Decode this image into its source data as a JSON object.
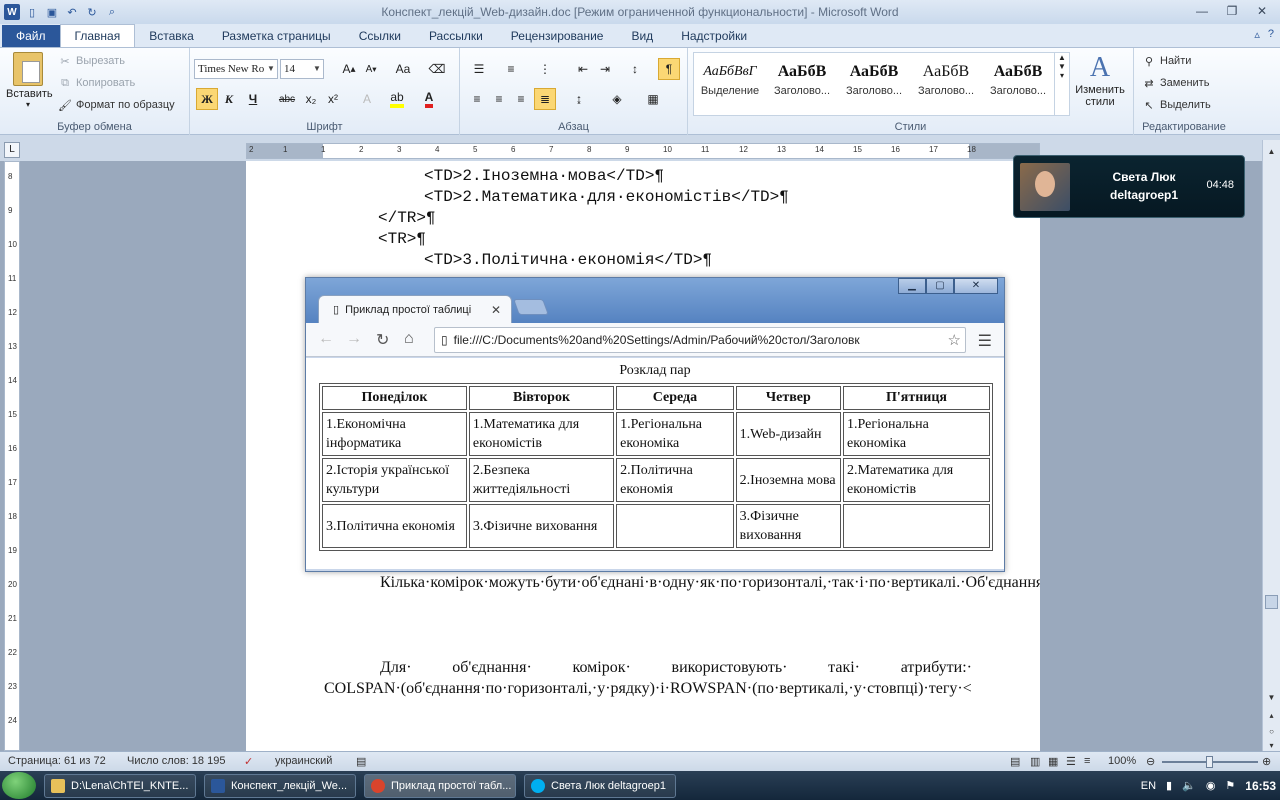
{
  "window": {
    "title": "Конспект_лекцій_Web-дизайн.doc [Режим ограниченной функциональности]  -  Microsoft Word",
    "icons": [
      "word-icon",
      "new-doc-icon",
      "save-icon",
      "undo-icon",
      "redo-icon",
      "print-preview-icon"
    ]
  },
  "ribbon_tabs": [
    "Файл",
    "Главная",
    "Вставка",
    "Разметка страницы",
    "Ссылки",
    "Рассылки",
    "Рецензирование",
    "Вид",
    "Надстройки"
  ],
  "ribbon": {
    "clipboard": {
      "paste": "Вставить",
      "cut": "Вырезать",
      "copy": "Копировать",
      "format_painter": "Формат по образцу",
      "label": "Буфер обмена"
    },
    "font": {
      "name": "Times New Ro",
      "size": "14",
      "bold": "Ж",
      "italic": "К",
      "underline": "Ч",
      "strike": "abc",
      "sub": "x₂",
      "sup": "x²",
      "label": "Шрифт"
    },
    "paragraph": {
      "label": "Абзац",
      "pilcrow": "¶"
    },
    "styles": {
      "items": [
        {
          "sample": "АаБбВвГ",
          "name": "Выделение"
        },
        {
          "sample": "АаБбВ",
          "name": "Заголово..."
        },
        {
          "sample": "АаБбВ",
          "name": "Заголово..."
        },
        {
          "sample": "АаБбВ",
          "name": "Заголово..."
        },
        {
          "sample": "АаБбВ",
          "name": "Заголово..."
        }
      ],
      "change": "Изменить стили",
      "label": "Стили"
    },
    "editing": {
      "find": "Найти",
      "replace": "Заменить",
      "select": "Выделить",
      "label": "Редактирование"
    }
  },
  "document": {
    "code_lines": [
      "<TD>2.Іноземна·мова</TD>¶",
      "<TD>2.Математика·для·економістів</TD>¶",
      "</TR>¶",
      "<TR>¶",
      "<TD>3.Політична·економія</TD>¶"
    ],
    "para1": "Кілька·комірок·можуть·бути·об'єднані·в·одну·як·по·горизонталі,·так·і·по·вертикалі.·Об'єднання·першого·типу·застосовують·тоді,·коли·потрібно·створити·для·кількох·стовпців·спільний·заголовок.·Коли·вміст·кількох·комірок·поспіль·у·стовпці·однаковий,·їх·об'єд¬нують·по·вертикалі.¶",
    "para2": "Для· об'єднання· комірок· використовують· такі· атрибути:· COLSPAN·(об'єднання·по·горизонталі,·у·рядку)·і·ROWSPAN·(по·вертикалі,·у·стовпці)·тегу·<TD>.·Значеннями·цих·атрибутів·є·кількість·об'єд¬нуваних·стовпців·або·рядків.·Наприклад,·C·0·L·S·P·A·N·=·3·означає,·що·комірка·розтягнута·на·3·стовпці,·а·R·0·"
  },
  "browser": {
    "tab_title": "Приклад простої таблиці",
    "url": "file:///C:/Documents%20and%20Settings/Admin/Рабочий%20стол/Заголовк",
    "caption": "Розклад пар",
    "headers": [
      "Понеділок",
      "Вівторок",
      "Середа",
      "Четвер",
      "П'ятниця"
    ],
    "rows": [
      [
        "1.Економічна інформатика",
        "1.Математика для економістів",
        "1.Регіональна економіка",
        "1.Web-дизайн",
        "1.Регіональна економіка"
      ],
      [
        "2.Історія української культури",
        "2.Безпека життедіяльності",
        "2.Політична економія",
        "2.Іноземна мова",
        "2.Математика для економістів"
      ],
      [
        "3.Політична економія",
        "3.Фізичне виховання",
        "",
        "3.Фізичне виховання",
        ""
      ]
    ]
  },
  "notification": {
    "name": "Света Люк",
    "user": "deltagroep1",
    "time": "04:48"
  },
  "statusbar": {
    "page": "Страница: 61 из 72",
    "words": "Число слов: 18 195",
    "language": "украинский",
    "zoom": "100%"
  },
  "taskbar": {
    "buttons": [
      {
        "label": "D:\\Lena\\ChTEI_KNTE...",
        "color": "#e8c15a"
      },
      {
        "label": "Конспект_лекцій_We...",
        "color": "#2b579a"
      },
      {
        "label": "Приклад простої табл...",
        "color": "#d9442c"
      },
      {
        "label": "Света Люк deltagroep1",
        "color": "#00aff0"
      }
    ],
    "lang": "EN",
    "clock": "16:53"
  },
  "ruler": {
    "h_numbers": [
      "2",
      "1",
      "1",
      "2",
      "3",
      "4",
      "5",
      "6",
      "7",
      "8",
      "9",
      "10",
      "11",
      "12",
      "13",
      "14",
      "15",
      "16",
      "17",
      "18"
    ],
    "v_numbers": [
      "8",
      "9",
      "10",
      "11",
      "12",
      "13",
      "14",
      "15",
      "16",
      "17",
      "18",
      "19",
      "20",
      "21",
      "22",
      "23",
      "24"
    ]
  }
}
